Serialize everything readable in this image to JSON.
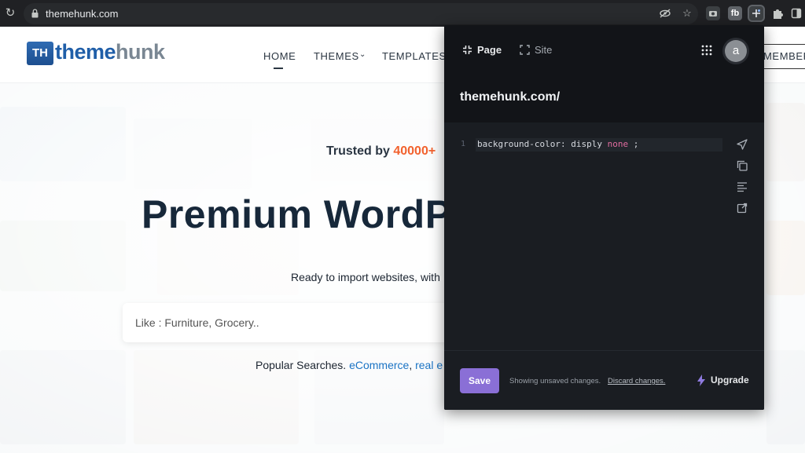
{
  "browser": {
    "url": "themehunk.com",
    "icons": [
      "reload-icon",
      "lock-icon",
      "eye-off-icon",
      "star-icon",
      "camera-extension-icon",
      "fb-extension-icon",
      "stylebot-extension-icon",
      "puzzle-icon",
      "sidebar-icon"
    ],
    "ext_fb_label": "fb"
  },
  "site": {
    "logo": {
      "mark": "TH",
      "text_a": "theme",
      "text_b": "hunk"
    },
    "nav": [
      "HOME",
      "THEMES",
      "TEMPLATES"
    ],
    "members_label": "MEMBERS",
    "hero": {
      "trusted_prefix": "Trusted by ",
      "trusted_count": "40000+",
      "title": "Premium WordP",
      "subtitle": "Ready to import websites, with",
      "search_placeholder": "Like : Furniture, Grocery..",
      "popular_label": "Popular Searches.",
      "popular_links": [
        "eCommerce",
        "real e"
      ],
      "popular_sep": ", "
    }
  },
  "panel": {
    "tabs": {
      "page": "Page",
      "site": "Site"
    },
    "avatar_letter": "a",
    "domain": "themehunk.com/",
    "editor": {
      "line_number": "1",
      "code_main": "background-color: disply ",
      "code_keyword": "none",
      "code_tail": " ;"
    },
    "tools": [
      "send-icon",
      "copy-icon",
      "format-icon",
      "open-external-icon"
    ],
    "footer": {
      "save_label": "Save",
      "unsaved_text": "Showing unsaved changes.",
      "discard_text": "Discard changes.",
      "upgrade_label": "Upgrade"
    },
    "colors": {
      "accent": "#8a6fd6",
      "keyword": "#e06c9f",
      "bg": "#1a1d22"
    }
  }
}
